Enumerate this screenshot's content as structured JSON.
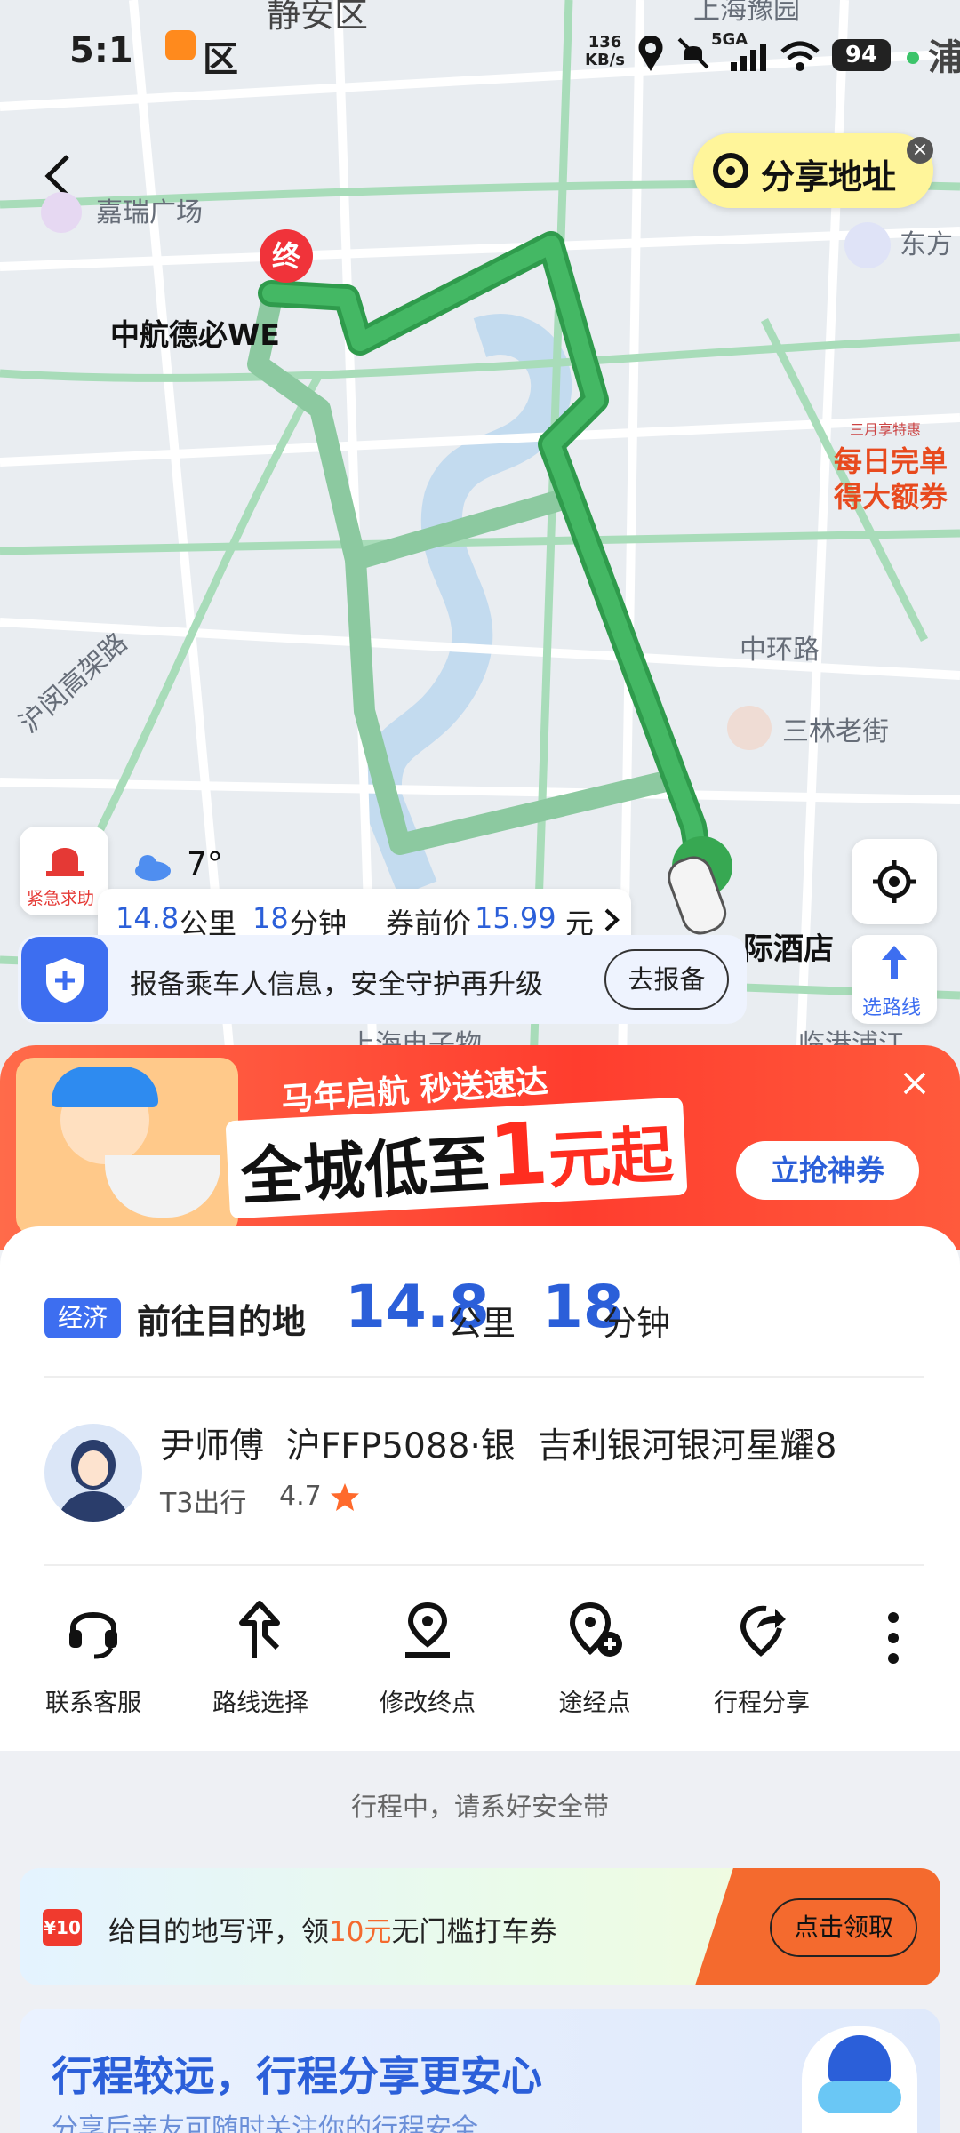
{
  "status_bar": {
    "time": "5:1",
    "district_partial": "区",
    "net_speed": "136\nKB/s",
    "net_speed_value": "136",
    "net_speed_unit": "KB/s",
    "signal": "5GA",
    "battery": "94"
  },
  "map": {
    "labels": {
      "jingan": "静安区",
      "jiarui": "嘉瑞广场",
      "dest_name": "中航德必WE",
      "dest_marker": "终",
      "dongfang": "东方",
      "zhonghuan": "中环路",
      "sanlin": "三林老街",
      "humin": "沪闵高架路",
      "hotel": "际酒店",
      "top_right": "浦",
      "shanghai_top": "上海豫园",
      "bottom_edge_a": "上海电子物",
      "bottom_edge_b": "临港浦江"
    },
    "share_address": "分享地址",
    "promo_badge_line1": "每日完单",
    "promo_badge_line2": "得大额券",
    "promo_badge_top": "三月享特惠",
    "emergency": "紧急求助",
    "weather": "7°",
    "trip_summary": {
      "distance_num": "14.8",
      "distance_unit": "公里",
      "minutes_num": "18",
      "minutes_unit": "分钟",
      "price_label": "券前价",
      "price_num": "15.99",
      "price_unit": "元"
    },
    "safety_banner": {
      "text": "报备乘车人信息，安全守护再升级",
      "button": "去报备"
    },
    "route_choice": "选路线"
  },
  "promo": {
    "headline_small": "马年启航 秒送速达",
    "headline_big_a": "全城低至",
    "headline_big_num": "1",
    "headline_big_b": "元起",
    "button": "立抢神券"
  },
  "trip": {
    "badge": "经济",
    "heading": "前往目的地",
    "distance_num": "14.8",
    "distance_unit": "公里",
    "minutes_num": "18",
    "minutes_unit": "分钟"
  },
  "driver": {
    "name": "尹师傅",
    "plate": "沪FFP5088·银",
    "car": "吉利银河银河星耀8",
    "company": "T3出行",
    "rating": "4.7"
  },
  "actions": [
    {
      "label": "联系客服",
      "icon": "headset-icon"
    },
    {
      "label": "路线选择",
      "icon": "route-icon"
    },
    {
      "label": "修改终点",
      "icon": "edit-destination-icon"
    },
    {
      "label": "途经点",
      "icon": "waypoint-add-icon"
    },
    {
      "label": "行程分享",
      "icon": "share-trip-icon"
    }
  ],
  "notice": "行程中，请系好安全带",
  "review_banner": {
    "coupon_tag": "¥10",
    "text_a": "给目的地写评，领",
    "text_highlight": "10元",
    "text_b": "无门槛打车券",
    "button": "点击领取"
  },
  "share_card": {
    "title": "行程较远，行程分享更安心",
    "subtitle": "分享后亲友可随时关注你的行程安全"
  },
  "colors": {
    "route_green": "#3dae5a",
    "route_alt": "#8cc9a0",
    "accent_blue": "#2b5fd9",
    "promo_red": "#ff3d2e"
  }
}
